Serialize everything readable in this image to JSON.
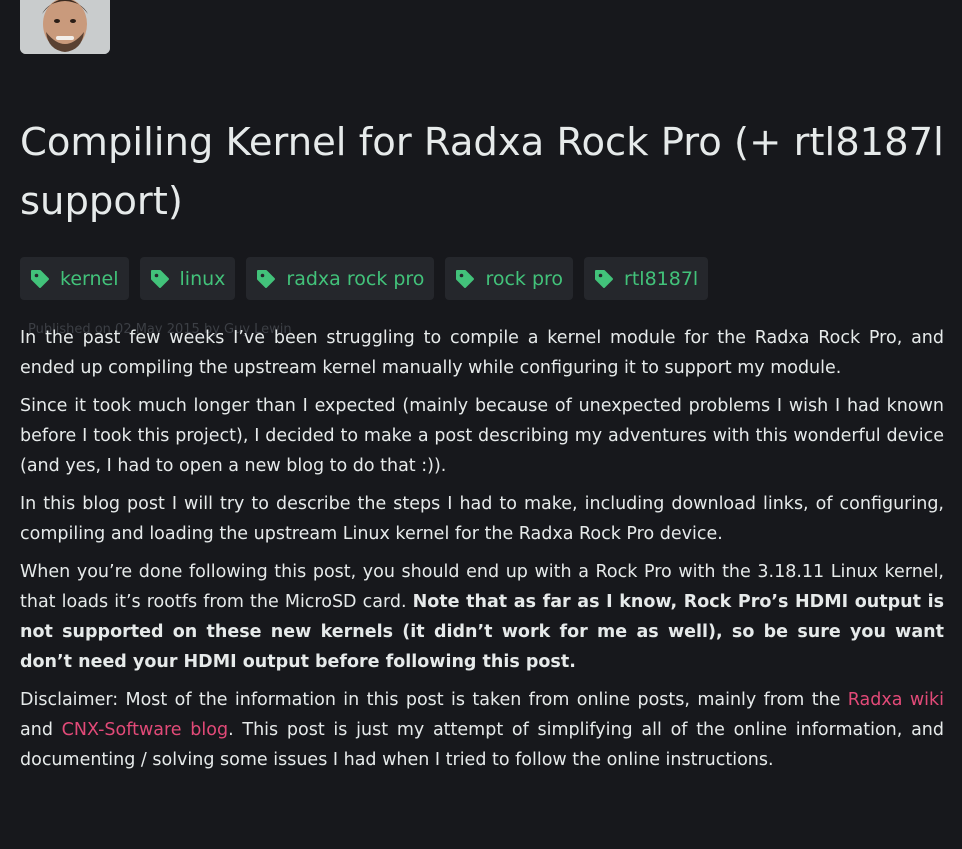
{
  "author": {
    "avatar_alt": "author-avatar"
  },
  "post": {
    "title": "Compiling Kernel for Radxa Rock Pro (+ rtl8187l support)",
    "tags": [
      "kernel",
      "linux",
      "radxa rock pro",
      "rock pro",
      "rtl8187l"
    ],
    "published": "Published on 02 May 2015 by Guy Lewin",
    "paragraphs": {
      "p1": "In the past few weeks I’ve been struggling to compile a kernel module for the Radxa Rock Pro, and ended up compiling the upstream kernel manually while configuring it to support my module.",
      "p2": "Since it took much longer than I expected (mainly because of unexpected problems I wish I had known before I took this project), I decided to make a post describing my adventures with this wonderful device (and yes, I had to open a new blog to do that :)).",
      "p3": "In this blog post I will try to describe the steps I had to make, including download links, of configuring, compiling and loading the upstream Linux kernel for the Radxa Rock Pro device.",
      "p4_text": "When you’re done following this post, you should end up with a Rock Pro with the 3.18.11 Linux kernel, that loads it’s rootfs from the MicroSD card. ",
      "p4_bold": "Note that as far as I know, Rock Pro’s HDMI output is not supported on these new kernels (it didn’t work for me as well), so be sure you want don’t need your HDMI output before following this post.",
      "p5_a": "Disclaimer: Most of the information in this post is taken from online posts, mainly from the ",
      "p5_link1": "Radxa wiki",
      "p5_b": " and ",
      "p5_link2": "CNX-Software blog",
      "p5_c": ". This post is just my attempt of simplifying all of the online information, and documenting / solving some issues I had when I tried to follow the online instructions."
    }
  },
  "colors": {
    "background": "#17181c",
    "text": "#e6eaea",
    "tag_text": "#42c27a",
    "tag_bg": "#25272c",
    "link": "#e24a78"
  },
  "icons": {
    "tag": "tag-icon"
  }
}
